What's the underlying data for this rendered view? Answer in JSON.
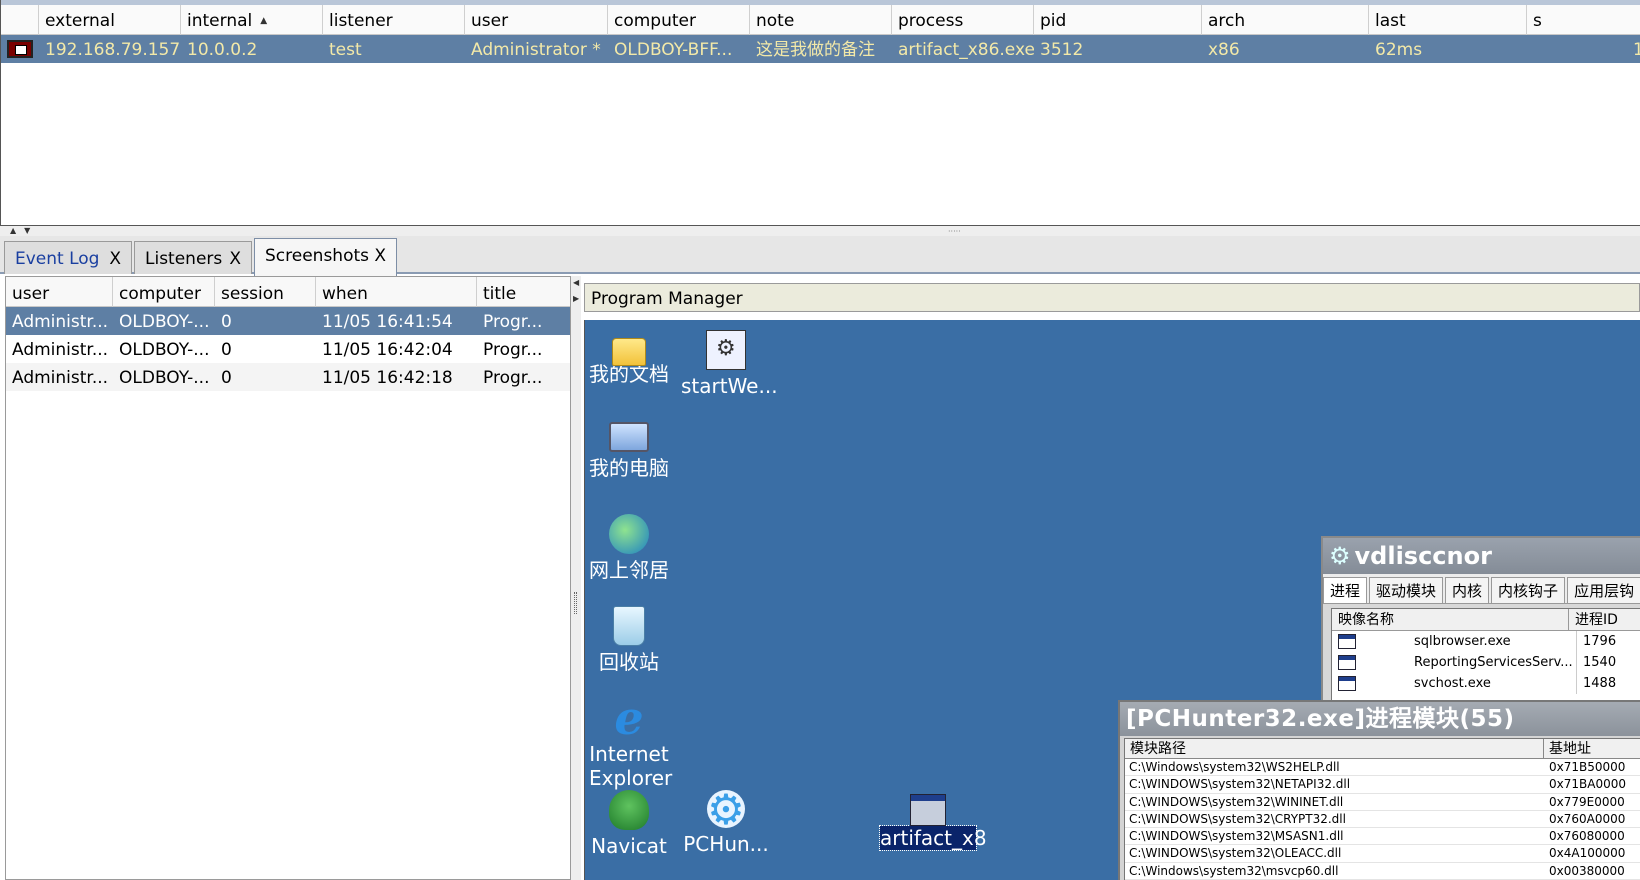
{
  "beacons": {
    "columns": [
      "external",
      "internal",
      "listener",
      "user",
      "computer",
      "note",
      "process",
      "pid",
      "arch",
      "last",
      "s"
    ],
    "sort_column": "internal",
    "rows": [
      {
        "external": "192.168.79.157",
        "internal": "10.0.0.2",
        "listener": "test",
        "user": "Administrator *",
        "computer": "OLDBOY-BFF...",
        "note": "这是我做的备注",
        "process": "artifact_x86.exe",
        "pid": "3512",
        "arch": "x86",
        "last": "62ms",
        "s": "1"
      }
    ]
  },
  "tabs": [
    {
      "label": "Event Log",
      "close": "X"
    },
    {
      "label": "Listeners",
      "close": "X"
    },
    {
      "label": "Screenshots",
      "close": "X"
    }
  ],
  "screenshots": {
    "columns": [
      "user",
      "computer",
      "session",
      "when",
      "title"
    ],
    "rows": [
      {
        "user": "Administr...",
        "computer": "OLDBOY-...",
        "session": "0",
        "when": "11/05 16:41:54",
        "title": "Progr..."
      },
      {
        "user": "Administr...",
        "computer": "OLDBOY-...",
        "session": "0",
        "when": "11/05 16:42:04",
        "title": "Progr..."
      },
      {
        "user": "Administr...",
        "computer": "OLDBOY-...",
        "session": "0",
        "when": "11/05 16:42:18",
        "title": "Progr..."
      }
    ],
    "selected_index": 0
  },
  "viewer": {
    "title": "Program Manager",
    "desktop_icons": [
      {
        "label": "我的文档",
        "icon": "folder-icon"
      },
      {
        "label": "startWe...",
        "icon": "script-icon"
      },
      {
        "label": "我的电脑",
        "icon": "computer-icon"
      },
      {
        "label": "网上邻居",
        "icon": "network-icon"
      },
      {
        "label": "回收站",
        "icon": "recycle-bin-icon"
      },
      {
        "label": "Internet",
        "label2": "Explorer",
        "icon": "internet-explorer-icon"
      },
      {
        "label": "Navicat",
        "icon": "navicat-icon"
      },
      {
        "label": "PCHun...",
        "icon": "pchunter-icon"
      },
      {
        "label": "artifact_x8",
        "icon": "window-icon"
      }
    ],
    "window_tool": {
      "title": "vdlisccnor",
      "tabs": [
        "进程",
        "驱动模块",
        "内核",
        "内核钩子",
        "应用层钩"
      ],
      "columns": [
        "映像名称",
        "进程ID"
      ],
      "rows": [
        {
          "name": "sqlbrowser.exe",
          "pid": "1796"
        },
        {
          "name": "ReportingServicesServ...",
          "pid": "1540"
        },
        {
          "name": "svchost.exe",
          "pid": "1488"
        }
      ]
    },
    "window_modules": {
      "title": "[PCHunter32.exe]进程模块(55)",
      "columns": [
        "模块路径",
        "基地址"
      ],
      "rows": [
        {
          "path": "C:\\Windows\\system32\\WS2HELP.dll",
          "base": "0x71B50000"
        },
        {
          "path": "C:\\WINDOWS\\system32\\NETAPI32.dll",
          "base": "0x71BA0000"
        },
        {
          "path": "C:\\WINDOWS\\system32\\WININET.dll",
          "base": "0x779E0000"
        },
        {
          "path": "C:\\WINDOWS\\system32\\CRYPT32.dll",
          "base": "0x760A0000"
        },
        {
          "path": "C:\\WINDOWS\\system32\\MSASN1.dll",
          "base": "0x76080000"
        },
        {
          "path": "C:\\WINDOWS\\system32\\OLEACC.dll",
          "base": "0x4A100000"
        },
        {
          "path": "C:\\Windows\\system32\\msvcp60.dll",
          "base": "0x00380000"
        }
      ]
    }
  },
  "colors": {
    "selection_bg": "#5e7fa4",
    "beacon_text": "#f3e9a8",
    "desktop_bg": "#3a6ea5",
    "tab_link": "#1a3fa0"
  }
}
